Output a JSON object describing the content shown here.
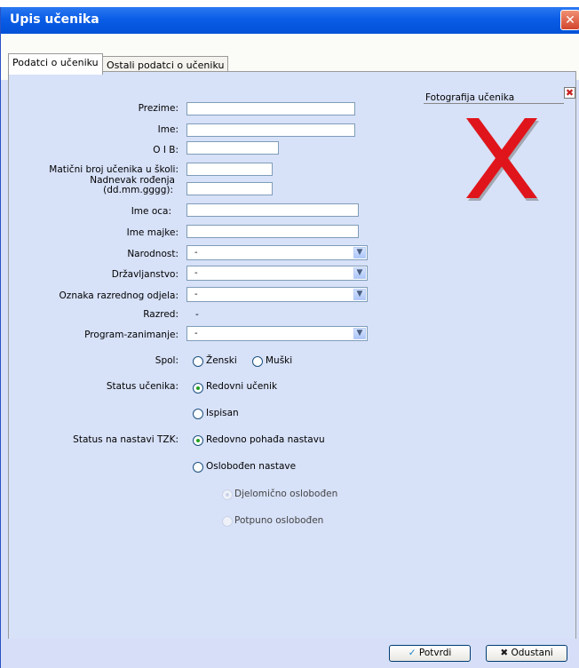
{
  "window": {
    "title": "Upis učenika",
    "close_glyph": "✕"
  },
  "tabs": [
    {
      "label": "Podatci o učeniku"
    },
    {
      "label": "Ostali podatci o učeniku"
    }
  ],
  "fields": {
    "prezime": "Prezime:",
    "ime": "Ime:",
    "oib": "O I B:",
    "maticni": "Matični broj učenika u školi:",
    "nadnevak_line1": "Nadnevak rođenja",
    "nadnevak_line2": "(dd.mm.gggg):",
    "ime_oca": "Ime oca:",
    "ime_majke": "Ime majke:",
    "narodnost": "Narodnost:",
    "drzavljanstvo": "Državljanstvo:",
    "oznaka": "Oznaka razrednog odjela:",
    "razred": "Razred:",
    "razred_value": "-",
    "program": "Program-zanimanje:",
    "spol": "Spol:",
    "status_ucenika": "Status učenika:",
    "status_tzk": "Status na nastavi TZK:"
  },
  "combos": {
    "narodnost": "-",
    "drzavljanstvo": "-",
    "oznaka": "-",
    "program": "-"
  },
  "radios": {
    "zenski": "Ženski",
    "muski": "Muški",
    "redovni": "Redovni učenik",
    "ispisan": "Ispisan",
    "redovno_pohada": "Redovno pohađa nastavu",
    "oslobodjen": "Oslobođen nastave",
    "djelomicno": "Djelomično oslobođen",
    "potpuno": "Potpuno oslobođen"
  },
  "photo": {
    "label": "Fotografija učenika",
    "clear_glyph": "✖",
    "placeholder_glyph": "X",
    "placeholder_color": "#e0151b"
  },
  "buttons": {
    "ok": "Potvrdi",
    "cancel": "Odustani",
    "ok_icon": "✓",
    "cancel_icon": "✖"
  },
  "colors": {
    "title_bar": "#0a5de6",
    "panel": "#d7e1f8",
    "accent_radio": "#21a121"
  }
}
